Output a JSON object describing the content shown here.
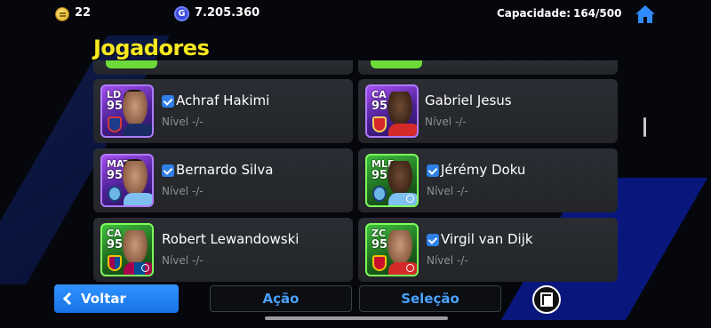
{
  "topbar": {
    "coins": "22",
    "gp_symbol": "G",
    "gp": "7.205.360",
    "capacity_label": "Capacidade:",
    "capacity_value": "164/500"
  },
  "page_title": "Jogadores",
  "players": [
    {
      "position": "LD",
      "rating": "95",
      "name": "Achraf Hakimi",
      "level": "Nível -/-",
      "verified": true,
      "card": "purple",
      "club": "psg"
    },
    {
      "position": "CA",
      "rating": "95",
      "name": "Gabriel Jesus",
      "level": "Nível -/-",
      "verified": false,
      "card": "purple",
      "club": "ars"
    },
    {
      "position": "MAT",
      "rating": "95",
      "name": "Bernardo Silva",
      "level": "Nível -/-",
      "verified": true,
      "card": "purple",
      "club": "mci"
    },
    {
      "position": "MLE",
      "rating": "95",
      "name": "Jérémy Doku",
      "level": "Nível -/-",
      "verified": true,
      "card": "green",
      "club": "mci"
    },
    {
      "position": "CA",
      "rating": "95",
      "name": "Robert Lewandowski",
      "level": "Nível -/-",
      "verified": false,
      "card": "green",
      "club": "fcb"
    },
    {
      "position": "ZC",
      "rating": "95",
      "name": "Virgil van Dijk",
      "level": "Nível -/-",
      "verified": true,
      "card": "green",
      "club": "liv"
    }
  ],
  "buttons": {
    "back": "Voltar",
    "action": "Ação",
    "selection": "Seleção"
  },
  "colors": {
    "title_yellow": "#f7e81f",
    "accent_blue": "#2f93ff",
    "verified_blue": "#2f7fe8"
  }
}
